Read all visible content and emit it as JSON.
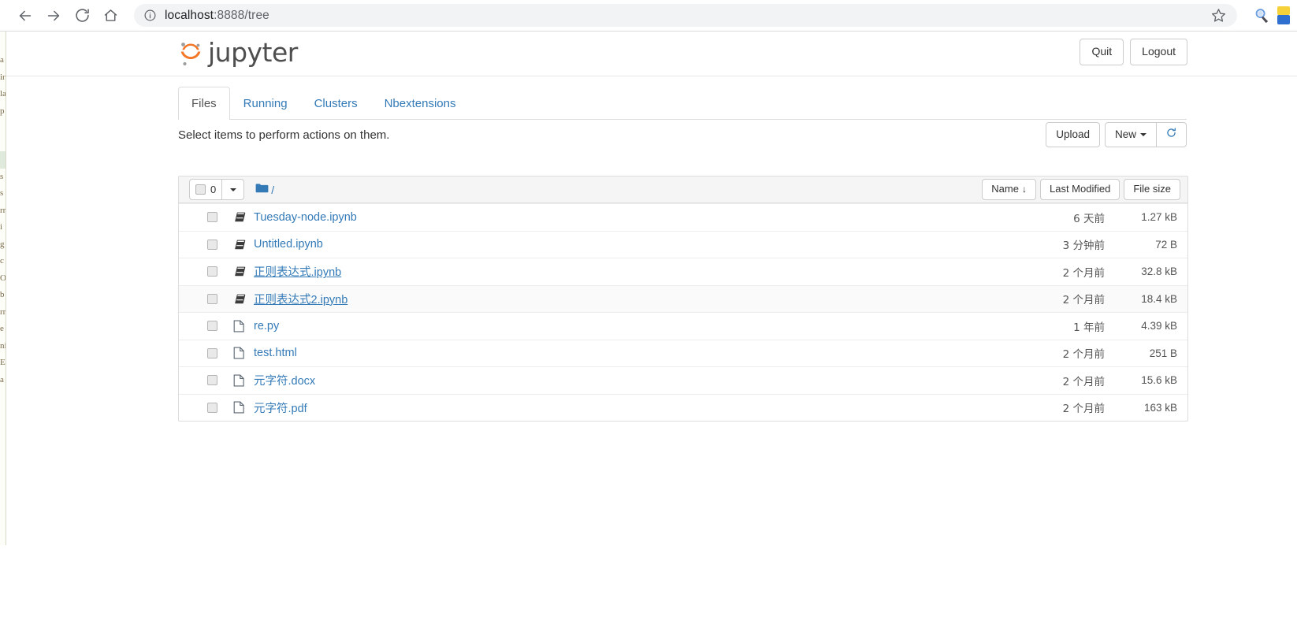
{
  "browser": {
    "back_icon": "arrow-left-icon",
    "forward_icon": "arrow-right-icon",
    "reload_icon": "reload-icon",
    "home_icon": "home-icon",
    "info_icon": "info-circle-icon",
    "url_host": "localhost",
    "url_path": ":8888/tree",
    "star_icon": "star-icon",
    "extension_icon": "magnifier-extension-icon",
    "profile_icon": "profile-avatar-icon"
  },
  "background_window": {
    "visible_chars": [
      "a",
      "ir",
      "la",
      "p",
      "",
      "s",
      "s",
      "rr",
      "i",
      "g",
      "c",
      "O",
      "b",
      "rr",
      "e",
      "ni",
      "E",
      "a"
    ]
  },
  "header": {
    "logo_text": "jupyter",
    "logo_color": "#f37726",
    "quit_label": "Quit",
    "logout_label": "Logout"
  },
  "tabs": [
    {
      "label": "Files",
      "active": true
    },
    {
      "label": "Running",
      "active": false
    },
    {
      "label": "Clusters",
      "active": false
    },
    {
      "label": "Nbextensions",
      "active": false
    }
  ],
  "actions": {
    "note": "Select items to perform actions on them.",
    "upload_label": "Upload",
    "new_label": "New",
    "refresh_icon": "refresh-icon"
  },
  "list_header": {
    "selected_count": "0",
    "breadcrumb_root": "/",
    "folder_icon": "folder-icon",
    "sort_name": "Name",
    "sort_name_arrow": "↓",
    "sort_modified": "Last Modified",
    "sort_size": "File size"
  },
  "files": [
    {
      "name": "Tuesday-node.ipynb",
      "icon": "notebook-icon",
      "modified": "6 天前",
      "size": "1.27 kB",
      "underlined": false
    },
    {
      "name": "Untitled.ipynb",
      "icon": "notebook-icon",
      "modified": "3 分钟前",
      "size": "72 B",
      "underlined": false
    },
    {
      "name": "正则表达式.ipynb",
      "icon": "notebook-icon",
      "modified": "2 个月前",
      "size": "32.8 kB",
      "underlined": true
    },
    {
      "name": "正则表达式2.ipynb",
      "icon": "notebook-icon",
      "modified": "2 个月前",
      "size": "18.4 kB",
      "underlined": true
    },
    {
      "name": "re.py",
      "icon": "file-icon",
      "modified": "1 年前",
      "size": "4.39 kB",
      "underlined": false
    },
    {
      "name": "test.html",
      "icon": "file-icon",
      "modified": "2 个月前",
      "size": "251 B",
      "underlined": false
    },
    {
      "name": "元字符.docx",
      "icon": "file-icon",
      "modified": "2 个月前",
      "size": "15.6 kB",
      "underlined": false
    },
    {
      "name": "元字符.pdf",
      "icon": "file-icon",
      "modified": "2 个月前",
      "size": "163 kB",
      "underlined": false
    }
  ],
  "colors": {
    "link": "#337ab7",
    "brand_orange": "#f37726",
    "header_bg": "#f5f5f5",
    "border": "#dddddd"
  }
}
